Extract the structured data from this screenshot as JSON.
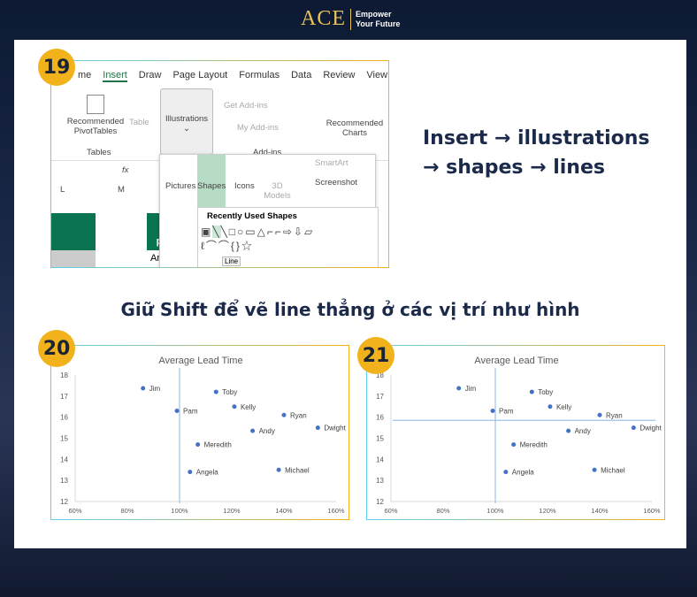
{
  "logo": {
    "brand": "ACE",
    "tagline1": "Empower",
    "tagline2": "Your Future"
  },
  "step19": {
    "badge": "19",
    "tabs": [
      "me",
      "Insert",
      "Draw",
      "Page Layout",
      "Formulas",
      "Data",
      "Review",
      "View"
    ],
    "active_tab": "Insert",
    "ribbon": {
      "pivot": "Recommended PivotTables",
      "table": "Table",
      "tables_group": "Tables",
      "illustrations": "Illustrations",
      "get_addins": "Get Add-ins",
      "my_addins": "My Add-ins",
      "addins_group": "Add-ins",
      "rec_charts": "Recommended Charts"
    },
    "formula_fx": "fx",
    "columns": [
      "L",
      "M"
    ],
    "cells": {
      "header": "Sales person",
      "value": "Andy"
    },
    "illustrations_menu": {
      "pictures": "Pictures",
      "shapes": "Shapes",
      "icons": "Icons",
      "models": "3D Models",
      "smartart": "SmartArt",
      "screenshot": "Screenshot"
    },
    "shapes_menu": {
      "title": "Recently Used Shapes",
      "tooltip": "Line"
    }
  },
  "step_instruction": {
    "line1": "Insert → illustrations",
    "line2": "→ shapes → lines"
  },
  "heading": "Giữ Shift để vẽ line thẳng ở các vị trí như hình",
  "chart_data": [
    {
      "badge": "20",
      "type": "scatter",
      "title": "Average Lead Time",
      "xlim": [
        0.6,
        1.6
      ],
      "ylim": [
        12,
        18
      ],
      "xticks": [
        "60%",
        "80%",
        "100%",
        "120%",
        "140%",
        "160%"
      ],
      "yticks": [
        "12",
        "13",
        "14",
        "15",
        "16",
        "17",
        "18"
      ],
      "points": [
        {
          "name": "Jim",
          "x": 0.86,
          "y": 17.37
        },
        {
          "name": "Toby",
          "x": 1.14,
          "y": 17.2
        },
        {
          "name": "Kelly",
          "x": 1.21,
          "y": 16.5
        },
        {
          "name": "Pam",
          "x": 0.99,
          "y": 16.3
        },
        {
          "name": "Ryan",
          "x": 1.4,
          "y": 16.1
        },
        {
          "name": "Dwight",
          "x": 1.53,
          "y": 15.5
        },
        {
          "name": "Andy",
          "x": 1.28,
          "y": 15.35
        },
        {
          "name": "Meredith",
          "x": 1.07,
          "y": 14.7
        },
        {
          "name": "Angela",
          "x": 1.04,
          "y": 13.4
        },
        {
          "name": "Michael",
          "x": 1.38,
          "y": 13.5
        }
      ],
      "vline": 1.0,
      "color": "#4472c4",
      "line_color": "#9dc3e6"
    },
    {
      "badge": "21",
      "type": "scatter",
      "title": "Average Lead Time",
      "xlim": [
        0.6,
        1.6
      ],
      "ylim": [
        12,
        18
      ],
      "xticks": [
        "60%",
        "80%",
        "100%",
        "120%",
        "140%",
        "160%"
      ],
      "yticks": [
        "12",
        "13",
        "14",
        "15",
        "16",
        "17",
        "18"
      ],
      "points": [
        {
          "name": "Jim",
          "x": 0.86,
          "y": 17.37
        },
        {
          "name": "Toby",
          "x": 1.14,
          "y": 17.2
        },
        {
          "name": "Kelly",
          "x": 1.21,
          "y": 16.5
        },
        {
          "name": "Pam",
          "x": 0.99,
          "y": 16.3
        },
        {
          "name": "Ryan",
          "x": 1.4,
          "y": 16.1
        },
        {
          "name": "Dwight",
          "x": 1.53,
          "y": 15.5
        },
        {
          "name": "Andy",
          "x": 1.28,
          "y": 15.35
        },
        {
          "name": "Meredith",
          "x": 1.07,
          "y": 14.7
        },
        {
          "name": "Angela",
          "x": 1.04,
          "y": 13.4
        },
        {
          "name": "Michael",
          "x": 1.38,
          "y": 13.5
        }
      ],
      "vline": 1.0,
      "hline": 15.85,
      "color": "#4472c4",
      "line_color": "#9dc3e6"
    }
  ]
}
